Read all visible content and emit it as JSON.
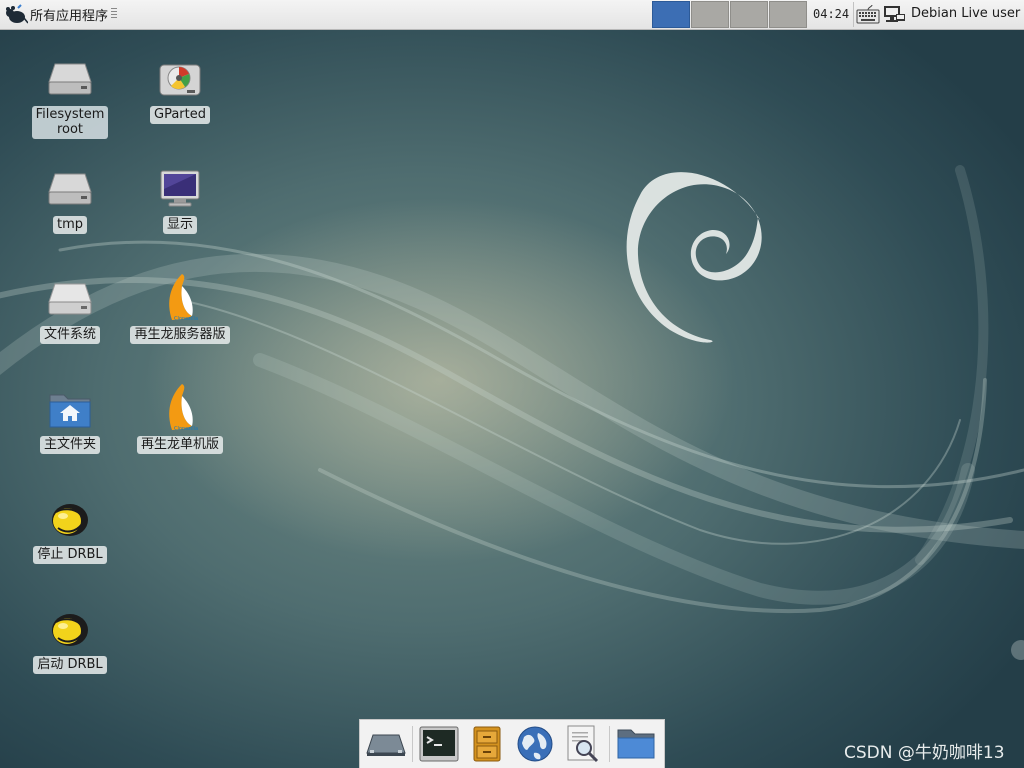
{
  "top_panel": {
    "apps_menu_label": "所有应用程序",
    "clock": "04:24",
    "user_label": "Debian Live user",
    "workspaces": [
      {
        "active": true
      },
      {
        "active": false
      },
      {
        "active": false
      },
      {
        "active": false
      }
    ]
  },
  "desktop": {
    "icons": [
      {
        "label": "Filesystem\nroot",
        "icon": "drive-icon"
      },
      {
        "label": "GParted",
        "icon": "gparted-icon"
      },
      {
        "label": "tmp",
        "icon": "drive-icon"
      },
      {
        "label": "显示",
        "icon": "monitor-icon"
      },
      {
        "label": "文件系统",
        "icon": "drive-icon"
      },
      {
        "label": "再生龙服务器版",
        "icon": "clonezilla-icon"
      },
      {
        "label": "主文件夹",
        "icon": "home-folder-icon"
      },
      {
        "label": "再生龙单机版",
        "icon": "clonezilla-icon"
      },
      {
        "label": "停止 DRBL",
        "icon": "drbl-icon"
      },
      {
        "label": "启动 DRBL",
        "icon": "drbl-icon"
      }
    ]
  },
  "dock": {
    "items": [
      {
        "icon": "show-desktop-icon"
      },
      {
        "icon": "terminal-icon"
      },
      {
        "icon": "file-manager-icon"
      },
      {
        "icon": "web-browser-icon"
      },
      {
        "icon": "app-finder-icon"
      },
      {
        "icon": "folder-icon"
      }
    ]
  },
  "watermark": "CSDN @牛奶咖啡13",
  "colors": {
    "workspace_active": "#3c6eb4",
    "workspace_inactive": "#a9a8a4",
    "wallpaper_dark": "#2f4c55",
    "wallpaper_light": "#6f8a84"
  }
}
